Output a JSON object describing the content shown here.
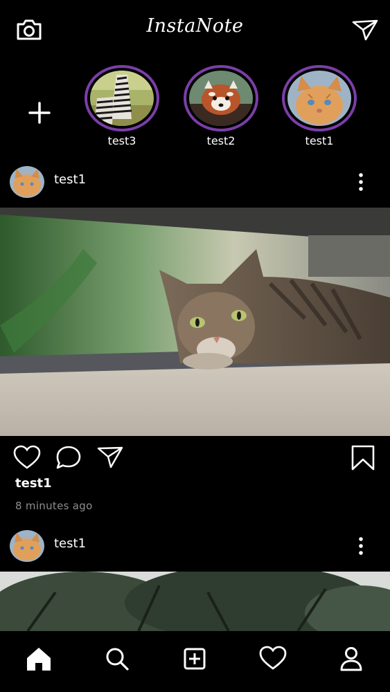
{
  "header": {
    "logo_text": "InstaNote",
    "camera_icon": "camera-icon",
    "send_icon": "paper-plane-icon"
  },
  "stories": {
    "add_icon": "plus-icon",
    "items": [
      {
        "label": "test3",
        "image": "zebra"
      },
      {
        "label": "test2",
        "image": "red-panda"
      },
      {
        "label": "test1",
        "image": "kitten"
      }
    ],
    "ring_color": "#7b3ea8"
  },
  "posts": [
    {
      "username": "test1",
      "image": "tabby-cat-under-shelf",
      "likes_user": "test1",
      "timestamp": "8 minutes ago"
    },
    {
      "username": "test1",
      "image": "trees"
    }
  ],
  "bottom_nav": {
    "items": [
      "home-icon",
      "search-icon",
      "add-post-icon",
      "heart-icon",
      "profile-icon"
    ]
  }
}
